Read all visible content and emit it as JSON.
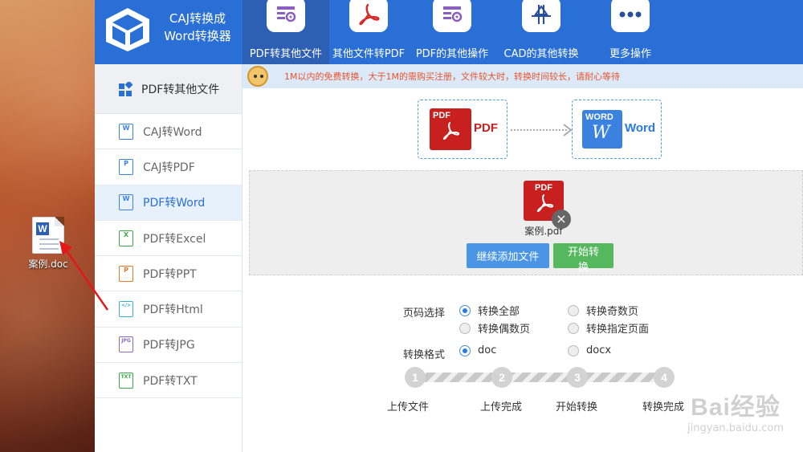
{
  "desktop": {
    "file_label": "案例.doc"
  },
  "app": {
    "brand_line1": "CAJ转换成",
    "brand_line2": "Word转换器"
  },
  "nav": [
    {
      "label": "PDF转其他文件",
      "icon": "gear-doc-icon"
    },
    {
      "label": "其他文件转PDF",
      "icon": "pdf-acrobat-icon"
    },
    {
      "label": "PDF的其他操作",
      "icon": "gear-doc-icon"
    },
    {
      "label": "CAD的其他转换",
      "icon": "cad-icon"
    },
    {
      "label": "更多操作",
      "icon": "more-dots-icon"
    }
  ],
  "sidebar": {
    "header": "PDF转其他文件",
    "items": [
      {
        "label": "CAJ转Word",
        "badge": "W"
      },
      {
        "label": "CAJ转PDF",
        "badge": "P"
      },
      {
        "label": "PDF转Word",
        "badge": "W"
      },
      {
        "label": "PDF转Excel",
        "badge": "X"
      },
      {
        "label": "PDF转PPT",
        "badge": "P"
      },
      {
        "label": "PDF转Html",
        "badge": "</>"
      },
      {
        "label": "PDF转JPG",
        "badge": "JPG"
      },
      {
        "label": "PDF转TXT",
        "badge": "TXT"
      }
    ]
  },
  "notice": "1M以内的免费转换，大于1M的需购买注册，文件较大时，转换时间较长，请耐心等待",
  "conversion": {
    "from_tile": "PDF",
    "from_label": "PDF",
    "to_tile": "WORD",
    "to_label": "Word"
  },
  "upload": {
    "file_tile": "PDF",
    "file_name": "案例.pdf",
    "add_button": "继续添加文件",
    "start_button": "开始转换"
  },
  "options": {
    "page_label": "页码选择",
    "page_all": "转换全部",
    "page_odd": "转换奇数页",
    "page_even": "转换偶数页",
    "page_custom": "转换指定页面",
    "format_label": "转换格式",
    "format_doc": "doc",
    "format_docx": "docx"
  },
  "steps": [
    {
      "num": "1",
      "label": "上传文件"
    },
    {
      "num": "2",
      "label": "上传完成"
    },
    {
      "num": "3",
      "label": "开始转换"
    },
    {
      "num": "4",
      "label": "转换完成"
    }
  ],
  "watermark": {
    "big": "Bai经验",
    "small": "jingyan.baidu.com"
  },
  "colors": {
    "header": "#2a6fd6",
    "active_nav": "#2d5fb4",
    "pdf_red": "#c8201e",
    "word_blue": "#3b82e0",
    "add_btn": "#4b95e6",
    "start_btn": "#55b85e"
  }
}
